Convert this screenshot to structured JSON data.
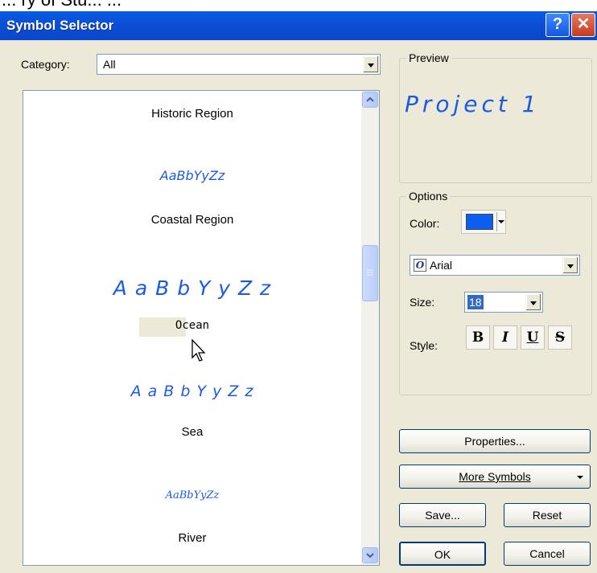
{
  "app": {
    "top_cropped_text": "... ry of Stu... ..."
  },
  "window": {
    "title": "Symbol Selector",
    "help_glyph": "?",
    "close_glyph": "✕"
  },
  "category": {
    "label": "Category:",
    "value": "All"
  },
  "symbols": {
    "items": [
      {
        "label": "Historic Region"
      },
      {
        "sample": "AaBbYyZz",
        "label": "Coastal Region"
      },
      {
        "sample": "A a B b Y y Z z",
        "label": "Ocean"
      },
      {
        "sample": "A a B b Y y Z z",
        "label": "Sea"
      },
      {
        "sample": "AaBbYyZz",
        "label": "River"
      }
    ],
    "selected": "Ocean"
  },
  "preview": {
    "title": "Preview",
    "text": "Project 1"
  },
  "options": {
    "title": "Options",
    "color_label": "Color:",
    "color_value": "#0b5ef0",
    "font_value": "Arial",
    "size_label": "Size:",
    "size_value": "18",
    "style_label": "Style:",
    "style_buttons": {
      "bold": "B",
      "italic": "I",
      "underline": "U",
      "strike": "S"
    }
  },
  "buttons": {
    "properties": "Properties...",
    "more_symbols": "More Symbols",
    "save": "Save...",
    "reset": "Reset",
    "ok": "OK",
    "cancel": "Cancel"
  },
  "icons": {
    "help": "help-icon",
    "close": "close-icon",
    "font": "opentype-font-icon",
    "cursor": "mouse-pointer-icon"
  }
}
